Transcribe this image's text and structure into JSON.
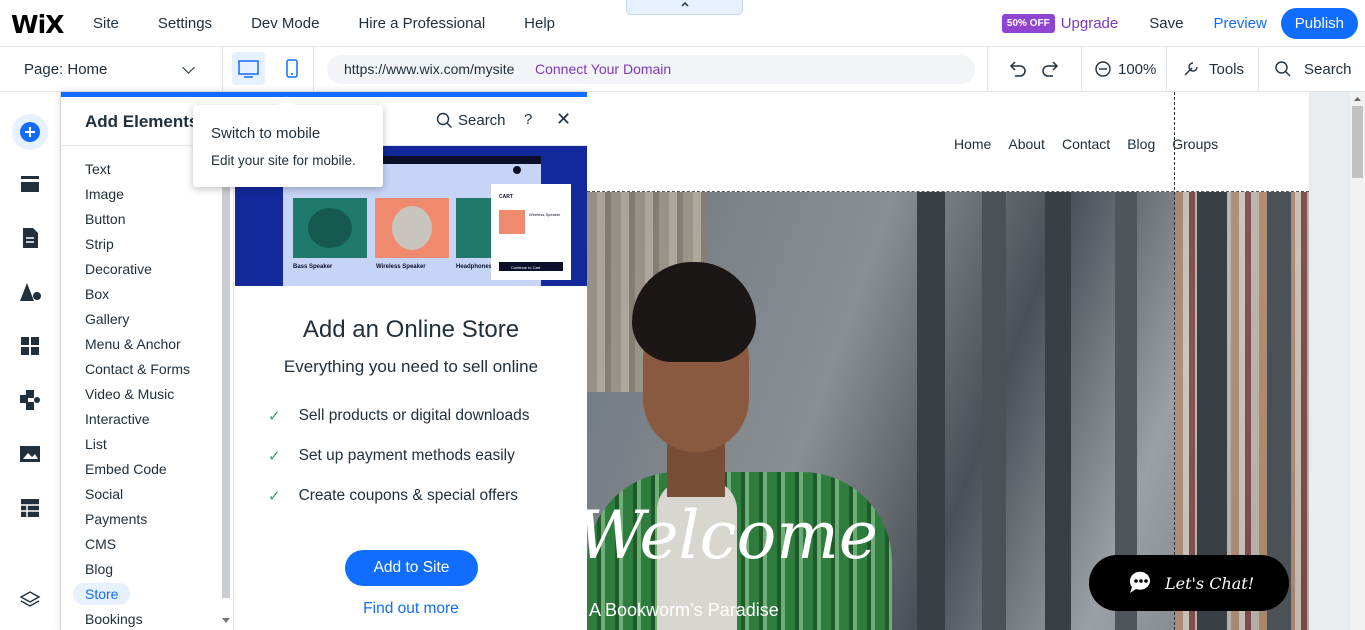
{
  "topbar": {
    "logo": "WiX",
    "menu": [
      "Site",
      "Settings",
      "Dev Mode",
      "Hire a Professional",
      "Help"
    ],
    "badge": "50% OFF",
    "upgrade": "Upgrade",
    "save": "Save",
    "preview": "Preview",
    "publish": "Publish",
    "collapse_arrow": "^"
  },
  "secondbar": {
    "page_label": "Page: Home",
    "url": "https://www.wix.com/mysite",
    "connect_domain": "Connect Your Domain",
    "zoom": "100%",
    "tools": "Tools",
    "search": "Search"
  },
  "panel": {
    "title": "Add Elements",
    "search": "Search",
    "help": "?",
    "close": "✕",
    "categories": [
      "Text",
      "Image",
      "Button",
      "Strip",
      "Decorative",
      "Box",
      "Gallery",
      "Menu & Anchor",
      "Contact & Forms",
      "Video & Music",
      "Interactive",
      "List",
      "Embed Code",
      "Social",
      "Payments",
      "CMS",
      "Blog",
      "Store",
      "Bookings"
    ],
    "active_category": "Store",
    "promo": {
      "title": "Add an Online Store",
      "subtitle": "Everything you need to sell online",
      "features": [
        "Sell products or digital downloads",
        "Set up payment methods easily",
        "Create coupons & special offers"
      ],
      "add_button": "Add to Site",
      "find_more": "Find out more",
      "img_products": [
        "Bass Speaker",
        "Wireless Speaker",
        "Headphones"
      ],
      "img_cart": "CART",
      "img_cart_item": "Wireless Speaker",
      "img_cart_button": "Continue to Cart"
    }
  },
  "tooltip": {
    "title": "Switch to mobile",
    "body": "Edit your site for mobile."
  },
  "site": {
    "nav": [
      "Home",
      "About",
      "Contact",
      "Blog",
      "Groups"
    ],
    "welcome": "Welcome",
    "tagline": "A Bookworm’s Paradise",
    "chat": "Let's Chat!"
  },
  "colors": {
    "accent": "#116dff",
    "upgrade": "#7c39c2",
    "badge": "#8f45d2"
  }
}
